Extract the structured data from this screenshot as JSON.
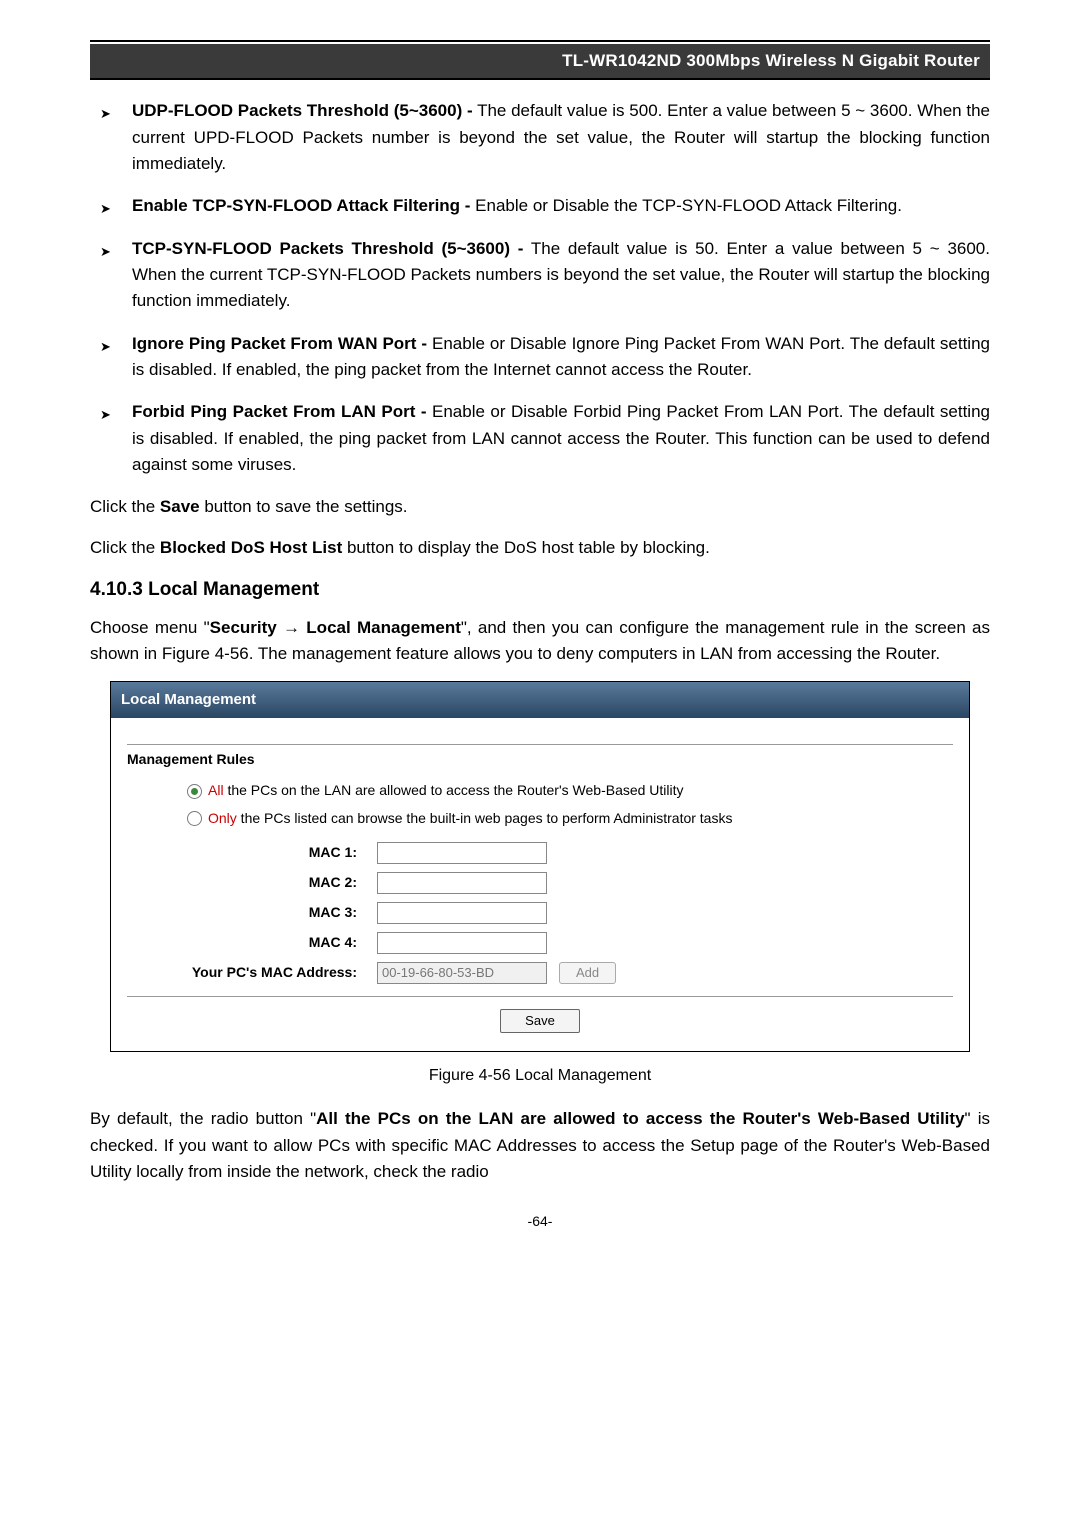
{
  "header": {
    "product_line": "TL-WR1042ND   300Mbps Wireless N Gigabit Router"
  },
  "bullets": [
    {
      "lead": "UDP-FLOOD Packets Threshold (5~3600) -",
      "rest": " The default value is 500. Enter a value between 5 ~ 3600. When the current UPD-FLOOD Packets number is beyond the set value, the Router will startup the blocking function immediately."
    },
    {
      "lead": "Enable TCP-SYN-FLOOD Attack Filtering -",
      "rest": " Enable or Disable the TCP-SYN-FLOOD Attack Filtering."
    },
    {
      "lead": "TCP-SYN-FLOOD Packets Threshold (5~3600) -",
      "rest": " The default value is 50. Enter a value between 5 ~ 3600. When the current TCP-SYN-FLOOD Packets numbers is beyond the set value, the Router will startup the blocking function immediately."
    },
    {
      "lead": "Ignore Ping Packet From WAN Port -",
      "rest": " Enable or Disable Ignore Ping Packet From WAN Port. The default setting is disabled. If enabled, the ping packet from the Internet cannot access the Router."
    },
    {
      "lead": "Forbid Ping Packet From LAN Port -",
      "rest": " Enable or Disable Forbid Ping Packet From LAN Port. The default setting is disabled. If enabled, the ping packet from LAN cannot access the Router. This function can be used to defend against some viruses."
    }
  ],
  "click_save_1a": "Click the ",
  "click_save_1b": "Save",
  "click_save_1c": " button to save the settings.",
  "click_blocked_1a": "Click the ",
  "click_blocked_1b": "Blocked DoS Host List",
  "click_blocked_1c": " button to display the DoS host table by blocking.",
  "section": {
    "number_title": "4.10.3  Local Management",
    "para_a": "Choose menu \"",
    "para_b": "Security",
    "arrow": " → ",
    "para_c": "Local Management",
    "para_d": "\", and then you can configure the management rule in the screen as shown in Figure 4-56. The management feature allows you to deny computers in LAN from accessing the Router."
  },
  "figure": {
    "title": "Local Management",
    "rules_heading": "Management Rules",
    "radio_all_red": "All",
    "radio_all_rest": " the PCs on the LAN are allowed to access the Router's Web-Based Utility",
    "radio_only_red": "Only",
    "radio_only_rest": " the PCs listed can browse the built-in web pages to perform Administrator tasks",
    "mac_labels": [
      "MAC 1:",
      "MAC 2:",
      "MAC 3:",
      "MAC 4:"
    ],
    "pc_mac_label": "Your PC's MAC Address:",
    "pc_mac_value": "00-19-66-80-53-BD",
    "add_label": "Add",
    "save_label": "Save"
  },
  "figure_caption": "Figure 4-56 Local Management",
  "closing_a": "By default, the radio button \"",
  "closing_b": "All the PCs on the LAN are allowed to access the Router's Web-Based Utility",
  "closing_c": "\" is checked. If you want to allow PCs with specific MAC Addresses to access the Setup page of the Router's Web-Based Utility locally from inside the network, check the radio",
  "page_number": "-64-"
}
